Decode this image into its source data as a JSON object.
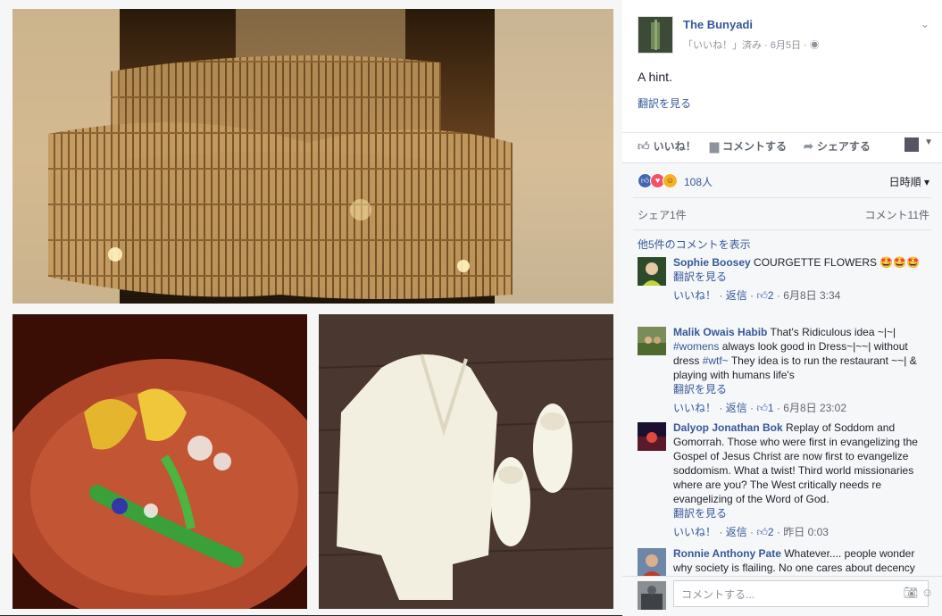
{
  "post": {
    "page_name": "The Bunyadi",
    "meta": "「いいね！」済み · 6月5日 · ",
    "text": "A hint.",
    "translate": "翻訳を見る"
  },
  "actions": {
    "like": "いいね！",
    "comment": "コメントする",
    "share": "シェアする"
  },
  "icons": {
    "like": "like-icon",
    "comment": "comment-icon",
    "share": "share-icon",
    "globe": "globe-icon",
    "camera": "camera-icon",
    "emoji": "emoji-icon",
    "chevron": "chevron-down-icon"
  },
  "stats": {
    "reaction_count": "108人",
    "sort": "日時順",
    "shares": "シェア1件",
    "comments": "コメント11件",
    "more_comments": "他5件のコメントを表示"
  },
  "comments": [
    {
      "name": "Sophie Boosey",
      "text": "COURGETTE FLOWERS 🤩🤩🤩",
      "translate": "翻訳を見る",
      "like": "いいね！",
      "reply": "返信",
      "likes": "2",
      "time": "6月8日 3:34"
    },
    {
      "name": "Malik Owais Habib",
      "text_a": "That's Ridiculous idea ~|~|",
      "tag1": "#womens",
      "text_b": "always look good in Dress~|~~| without dress",
      "tag2": "#wtf~",
      "text_c": "They idea is to run the restaurant ~~| & playing with humans life's",
      "translate": "翻訳を見る",
      "like": "いいね！",
      "reply": "返信",
      "likes": "1",
      "time": "6月8日 23:02"
    },
    {
      "name": "Dalyop Jonathan Bok",
      "text": "Replay of Soddom and Gomorrah. Those who were first in evangelizing the Gospel of Jesus Christ are now first to evangelize soddomism. What a twist! Third world missionaries where are you? The West critically needs re evangelizing of the Word of God.",
      "translate": "翻訳を見る",
      "like": "いいね！",
      "reply": "返信",
      "likes": "2",
      "time": "昨日 0:03"
    },
    {
      "name": "Ronnie Anthony Pate",
      "text": "Whatever.... people wonder why society is flailing. No one cares about decency"
    }
  ],
  "compose": {
    "placeholder": "コメントする..."
  }
}
